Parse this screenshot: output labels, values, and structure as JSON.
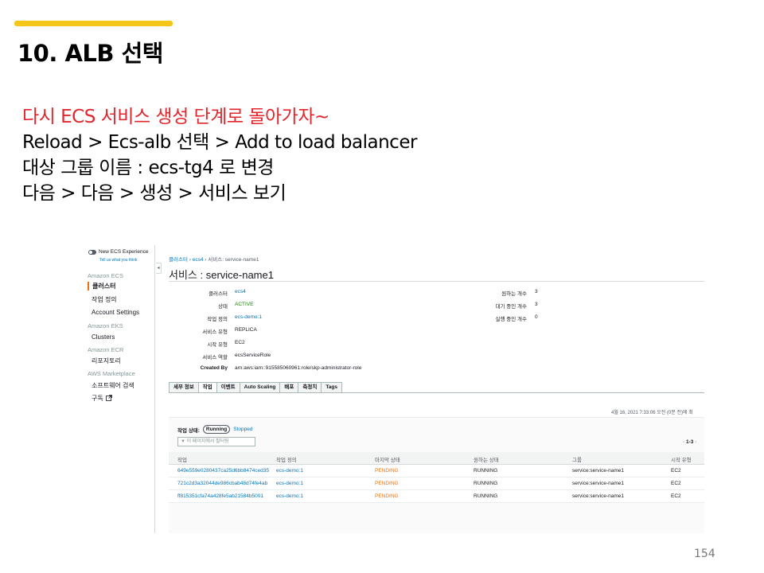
{
  "slide": {
    "title": "10. ALB 선택",
    "page_number": "154",
    "accent_color": "#f5c518",
    "notes": [
      {
        "text": "다시 ECS 서비스 생성 단계로 돌아가자~",
        "color": "#e3262d"
      },
      {
        "text": "Reload > Ecs-alb 선택 > Add to load balancer",
        "color": "#000000"
      },
      {
        "text": "대상 그룹 이름 : ecs-tg4 로 변경",
        "color": "#000000"
      },
      {
        "text": "다음 > 다음 > 생성 > 서비스 보기",
        "color": "#000000"
      }
    ]
  },
  "console": {
    "sidebar": {
      "toggle_label": "New ECS Experience",
      "tell_link": "Tell us what you think",
      "items": [
        {
          "label": "Amazon ECS",
          "kind": "section"
        },
        {
          "label": "클러스터",
          "kind": "active"
        },
        {
          "label": "작업 정의",
          "kind": "item"
        },
        {
          "label": "Account Settings",
          "kind": "item"
        },
        {
          "label": "Amazon EKS",
          "kind": "section"
        },
        {
          "label": "Clusters",
          "kind": "item"
        },
        {
          "label": "Amazon ECR",
          "kind": "section"
        },
        {
          "label": "리포지토리",
          "kind": "item"
        },
        {
          "label": "AWS Marketplace",
          "kind": "section"
        },
        {
          "label": "소프트웨어 검색",
          "kind": "item"
        },
        {
          "label": "구독",
          "kind": "item",
          "icon": "external-link-icon"
        }
      ]
    },
    "breadcrumb": {
      "root": "클러스터",
      "cluster": "ecs4",
      "current": "서비스: service-name1"
    },
    "page_title": "서비스 : service-name1",
    "details_left": [
      {
        "label": "클러스터",
        "value": "ecs4",
        "style": "link"
      },
      {
        "label": "상태",
        "value": "ACTIVE",
        "style": "ok"
      },
      {
        "label": "작업 정의",
        "value": "ecs-demo:1",
        "style": "link"
      },
      {
        "label": "서비스 유형",
        "value": "REPLICA",
        "style": "plain"
      },
      {
        "label": "시작 유형",
        "value": "EC2",
        "style": "plain"
      },
      {
        "label": "서비스 역할",
        "value": "ecsServiceRole",
        "style": "plain"
      },
      {
        "label": "Created By",
        "value": "arn:aws:iam::915585060961:role/skp-administrator-role",
        "style": "plain"
      }
    ],
    "details_right": [
      {
        "label": "원하는 개수",
        "value": "3"
      },
      {
        "label": "대기 중인 개수",
        "value": "3"
      },
      {
        "label": "실행 중인 개수",
        "value": "0"
      }
    ],
    "tabs": [
      "세부 정보",
      "작업",
      "이벤트",
      "Auto Scaling",
      "배포",
      "측정치",
      "Tags"
    ],
    "active_tab": "작업",
    "timestamp": "4월 16, 2021 7:33:06 오전 (0분 전)에 최",
    "task_status": {
      "label": "작업 상태:",
      "running": "Running",
      "stopped": "Stopped"
    },
    "filter_placeholder": "▼ 이 페이지에서 필터링",
    "pager": {
      "prev": "‹",
      "range": "1-3",
      "next": "›"
    },
    "table": {
      "headers": [
        "작업",
        "작업 정의",
        "마지막 상태",
        "원하는 상태",
        "그룹",
        "시작 유형"
      ],
      "rows": [
        [
          "649e559e0280437ca25d6bb8474ced35",
          "ecs-demo:1",
          "PENDING",
          "RUNNING",
          "service:service-name1",
          "EC2"
        ],
        [
          "721c2d3a32044de986cbab48d74fe4ab",
          "ecs-demo:1",
          "PENDING",
          "RUNNING",
          "service:service-name1",
          "EC2"
        ],
        [
          "ff815351cfa74a428fe5ab21584b5001",
          "ecs-demo:1",
          "PENDING",
          "RUNNING",
          "service:service-name1",
          "EC2"
        ]
      ]
    }
  }
}
